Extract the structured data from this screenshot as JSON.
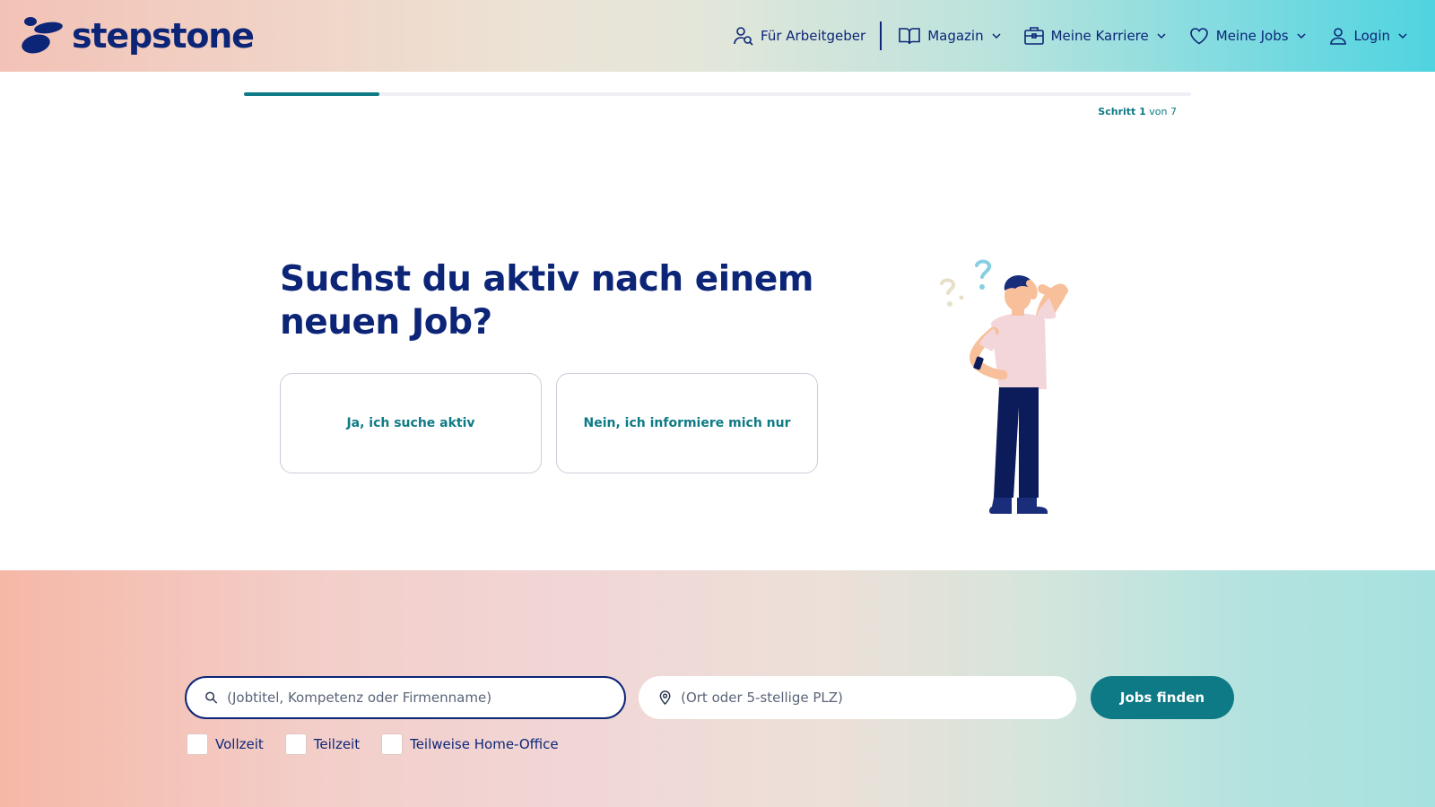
{
  "header": {
    "logo_text": "stepstone",
    "nav": [
      {
        "label": "Für Arbeitgeber",
        "icon": "employer-search-icon"
      },
      {
        "label": "Magazin",
        "icon": "book-icon"
      },
      {
        "label": "Meine Karriere",
        "icon": "briefcase-icon"
      },
      {
        "label": "Meine Jobs",
        "icon": "heart-icon"
      },
      {
        "label": "Login",
        "icon": "user-icon"
      }
    ]
  },
  "progress": {
    "step_label": "Schritt 1",
    "of_label": "von 7",
    "current": 1,
    "total": 7
  },
  "question": {
    "title": "Suchst du aktiv nach einem neuen Job?",
    "answers": [
      "Ja, ich suche aktiv",
      "Nein, ich informiere mich nur"
    ]
  },
  "search": {
    "keyword_placeholder": "(Jobtitel, Kompetenz oder Firmenname)",
    "location_placeholder": "(Ort oder 5-stellige PLZ)",
    "button_label": "Jobs finden",
    "filters": [
      "Vollzeit",
      "Teilzeit",
      "Teilweise Home-Office"
    ]
  },
  "colors": {
    "brand_navy": "#0c2577",
    "accent_teal": "#0e7a85"
  }
}
